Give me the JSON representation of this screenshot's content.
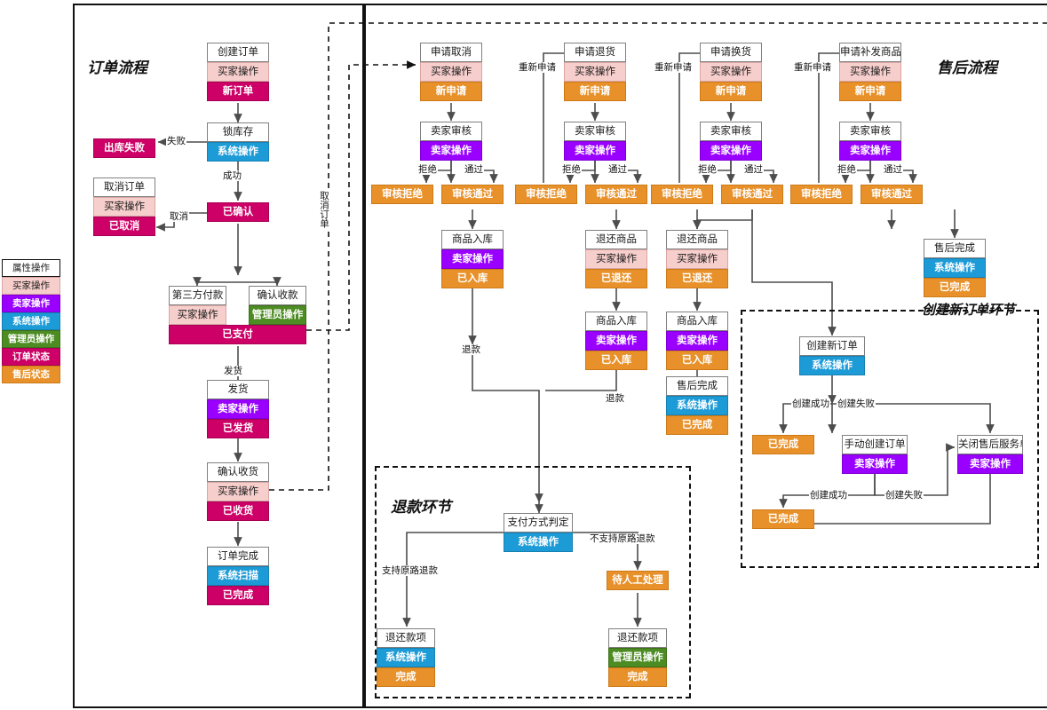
{
  "titles": {
    "order_flow": "订单流程",
    "aftersale_flow": "售后流程",
    "refund_stage": "退款环节",
    "new_order_stage": "创建新订单环节"
  },
  "legend": {
    "name": "legend",
    "items": [
      {
        "label": "属性操作",
        "kind": "title",
        "color": "#ffffff"
      },
      {
        "label": "买家操作",
        "kind": "buyer",
        "color": "#f6cecc"
      },
      {
        "label": "卖家操作",
        "kind": "seller",
        "color": "#9900ff"
      },
      {
        "label": "系统操作",
        "kind": "system",
        "color": "#1d9bd7"
      },
      {
        "label": "管理员操作",
        "kind": "admin",
        "color": "#4d8c23"
      },
      {
        "label": "订单状态",
        "kind": "order",
        "color": "#cc0066"
      },
      {
        "label": "售后状态",
        "kind": "after",
        "color": "#e8912a"
      }
    ]
  },
  "order_flow": {
    "nodes": [
      {
        "id": "create_order",
        "rows": [
          {
            "t": "创建订单",
            "k": "title"
          },
          {
            "t": "买家操作",
            "k": "buyer"
          },
          {
            "t": "新订单",
            "k": "order"
          }
        ]
      },
      {
        "id": "lock_stock",
        "rows": [
          {
            "t": "锁库存",
            "k": "title"
          },
          {
            "t": "系统操作",
            "k": "system"
          }
        ]
      },
      {
        "id": "out_fail",
        "rows": [
          {
            "t": "出库失败",
            "k": "order"
          }
        ]
      },
      {
        "id": "cancel_order",
        "rows": [
          {
            "t": "取消订单",
            "k": "title"
          },
          {
            "t": "买家操作",
            "k": "buyer"
          },
          {
            "t": "已取消",
            "k": "order"
          }
        ]
      },
      {
        "id": "confirmed",
        "rows": [
          {
            "t": "已确认",
            "k": "order"
          }
        ]
      },
      {
        "id": "third_pay",
        "rows": [
          {
            "t": "第三方付款",
            "k": "title"
          },
          {
            "t": "买家操作",
            "k": "buyer"
          }
        ]
      },
      {
        "id": "confirm_receipt_money",
        "rows": [
          {
            "t": "确认收款",
            "k": "title"
          },
          {
            "t": "管理员操作",
            "k": "admin"
          }
        ]
      },
      {
        "id": "paid",
        "rows": [
          {
            "t": "已支付",
            "k": "order"
          }
        ]
      },
      {
        "id": "ship",
        "rows": [
          {
            "t": "发货",
            "k": "title"
          },
          {
            "t": "卖家操作",
            "k": "seller"
          },
          {
            "t": "已发货",
            "k": "order"
          }
        ]
      },
      {
        "id": "confirm_receive",
        "rows": [
          {
            "t": "确认收货",
            "k": "title"
          },
          {
            "t": "买家操作",
            "k": "buyer"
          },
          {
            "t": "已收货",
            "k": "order"
          }
        ]
      },
      {
        "id": "order_done",
        "rows": [
          {
            "t": "订单完成",
            "k": "title"
          },
          {
            "t": "系统扫描",
            "k": "system"
          },
          {
            "t": "已完成",
            "k": "order"
          }
        ]
      }
    ],
    "edge_labels": [
      "失败",
      "成功",
      "取消",
      "发货",
      "取消订单"
    ]
  },
  "aftersale_flow": {
    "columns": [
      {
        "id": "cancel",
        "nodes": [
          {
            "id": "apply_cancel",
            "rows": [
              {
                "t": "申请取消",
                "k": "title"
              },
              {
                "t": "买家操作",
                "k": "buyer"
              },
              {
                "t": "新申请",
                "k": "after"
              }
            ]
          },
          {
            "id": "seller_review",
            "rows": [
              {
                "t": "卖家审核",
                "k": "title"
              },
              {
                "t": "卖家操作",
                "k": "seller"
              }
            ]
          },
          {
            "id": "review_reject",
            "rows": [
              {
                "t": "审核拒绝",
                "k": "after"
              }
            ]
          },
          {
            "id": "review_pass",
            "rows": [
              {
                "t": "审核通过",
                "k": "after"
              }
            ]
          },
          {
            "id": "goods_in",
            "rows": [
              {
                "t": "商品入库",
                "k": "title"
              },
              {
                "t": "卖家操作",
                "k": "seller"
              },
              {
                "t": "已入库",
                "k": "after"
              }
            ]
          }
        ]
      },
      {
        "id": "return",
        "nodes": [
          {
            "id": "apply_return",
            "rows": [
              {
                "t": "申请退货",
                "k": "title"
              },
              {
                "t": "买家操作",
                "k": "buyer"
              },
              {
                "t": "新申请",
                "k": "after"
              }
            ]
          },
          {
            "id": "seller_review",
            "rows": [
              {
                "t": "卖家审核",
                "k": "title"
              },
              {
                "t": "卖家操作",
                "k": "seller"
              }
            ]
          },
          {
            "id": "review_reject",
            "rows": [
              {
                "t": "审核拒绝",
                "k": "after"
              }
            ]
          },
          {
            "id": "review_pass",
            "rows": [
              {
                "t": "审核通过",
                "k": "after"
              }
            ]
          },
          {
            "id": "return_goods",
            "rows": [
              {
                "t": "退还商品",
                "k": "title"
              },
              {
                "t": "买家操作",
                "k": "buyer"
              },
              {
                "t": "已退还",
                "k": "after"
              }
            ]
          },
          {
            "id": "goods_in",
            "rows": [
              {
                "t": "商品入库",
                "k": "title"
              },
              {
                "t": "卖家操作",
                "k": "seller"
              },
              {
                "t": "已入库",
                "k": "after"
              }
            ]
          }
        ]
      },
      {
        "id": "exchange",
        "nodes": [
          {
            "id": "apply_exchange",
            "rows": [
              {
                "t": "申请换货",
                "k": "title"
              },
              {
                "t": "买家操作",
                "k": "buyer"
              },
              {
                "t": "新申请",
                "k": "after"
              }
            ]
          },
          {
            "id": "seller_review",
            "rows": [
              {
                "t": "卖家审核",
                "k": "title"
              },
              {
                "t": "卖家操作",
                "k": "seller"
              }
            ]
          },
          {
            "id": "review_reject",
            "rows": [
              {
                "t": "审核拒绝",
                "k": "after"
              }
            ]
          },
          {
            "id": "review_pass",
            "rows": [
              {
                "t": "审核通过",
                "k": "after"
              }
            ]
          },
          {
            "id": "return_goods",
            "rows": [
              {
                "t": "退还商品",
                "k": "title"
              },
              {
                "t": "买家操作",
                "k": "buyer"
              },
              {
                "t": "已退还",
                "k": "after"
              }
            ]
          },
          {
            "id": "goods_in",
            "rows": [
              {
                "t": "商品入库",
                "k": "title"
              },
              {
                "t": "卖家操作",
                "k": "seller"
              },
              {
                "t": "已入库",
                "k": "after"
              }
            ]
          },
          {
            "id": "after_done",
            "rows": [
              {
                "t": "售后完成",
                "k": "title"
              },
              {
                "t": "系统操作",
                "k": "system"
              },
              {
                "t": "已完成",
                "k": "after"
              }
            ]
          }
        ]
      },
      {
        "id": "reship",
        "nodes": [
          {
            "id": "apply_reship",
            "rows": [
              {
                "t": "申请补发商品",
                "k": "title"
              },
              {
                "t": "买家操作",
                "k": "buyer"
              },
              {
                "t": "新申请",
                "k": "after"
              }
            ]
          },
          {
            "id": "seller_review",
            "rows": [
              {
                "t": "卖家审核",
                "k": "title"
              },
              {
                "t": "卖家操作",
                "k": "seller"
              }
            ]
          },
          {
            "id": "review_reject",
            "rows": [
              {
                "t": "审核拒绝",
                "k": "after"
              }
            ]
          },
          {
            "id": "review_pass",
            "rows": [
              {
                "t": "审核通过",
                "k": "after"
              }
            ]
          },
          {
            "id": "after_done",
            "rows": [
              {
                "t": "售后完成",
                "k": "title"
              },
              {
                "t": "系统操作",
                "k": "system"
              },
              {
                "t": "已完成",
                "k": "after"
              }
            ]
          }
        ]
      }
    ],
    "edge_labels": [
      "重新申请",
      "拒绝",
      "通过",
      "退款"
    ]
  },
  "refund_stage": {
    "nodes": [
      {
        "id": "pay_method_judge",
        "rows": [
          {
            "t": "支付方式判定",
            "k": "title"
          },
          {
            "t": "系统操作",
            "k": "system"
          }
        ]
      },
      {
        "id": "manual_pending",
        "rows": [
          {
            "t": "待人工处理",
            "k": "after"
          }
        ]
      },
      {
        "id": "refund_sys",
        "rows": [
          {
            "t": "退还款项",
            "k": "title"
          },
          {
            "t": "系统操作",
            "k": "system"
          },
          {
            "t": "完成",
            "k": "after"
          }
        ]
      },
      {
        "id": "refund_admin",
        "rows": [
          {
            "t": "退还款项",
            "k": "title"
          },
          {
            "t": "管理员操作",
            "k": "admin"
          },
          {
            "t": "完成",
            "k": "after"
          }
        ]
      }
    ],
    "edge_labels": [
      "支持原路退款",
      "不支持原路退款"
    ]
  },
  "new_order_stage": {
    "nodes": [
      {
        "id": "create_new_order",
        "rows": [
          {
            "t": "创建新订单",
            "k": "title"
          },
          {
            "t": "系统操作",
            "k": "system"
          }
        ]
      },
      {
        "id": "done_1",
        "rows": [
          {
            "t": "已完成",
            "k": "after"
          }
        ]
      },
      {
        "id": "manual_create",
        "rows": [
          {
            "t": "手动创建订单",
            "k": "title"
          },
          {
            "t": "卖家操作",
            "k": "seller"
          }
        ]
      },
      {
        "id": "close_ticket",
        "rows": [
          {
            "t": "关闭售后服务单",
            "k": "title"
          },
          {
            "t": "卖家操作",
            "k": "seller"
          }
        ]
      },
      {
        "id": "done_2",
        "rows": [
          {
            "t": "已完成",
            "k": "after"
          }
        ]
      }
    ],
    "edge_labels": [
      "创建成功",
      "创建失败",
      "创建成功",
      "创建失败"
    ]
  },
  "edge_label_texts": {
    "fail": "失败",
    "success": "成功",
    "cancel": "取消",
    "ship": "发货",
    "cancel_order": "取消订单",
    "reapply": "重新申请",
    "reject": "拒绝",
    "pass": "通过",
    "refund": "退款",
    "support_original": "支持原路退款",
    "no_support_original": "不支持原路退款",
    "create_ok": "创建成功",
    "create_fail": "创建失败"
  }
}
